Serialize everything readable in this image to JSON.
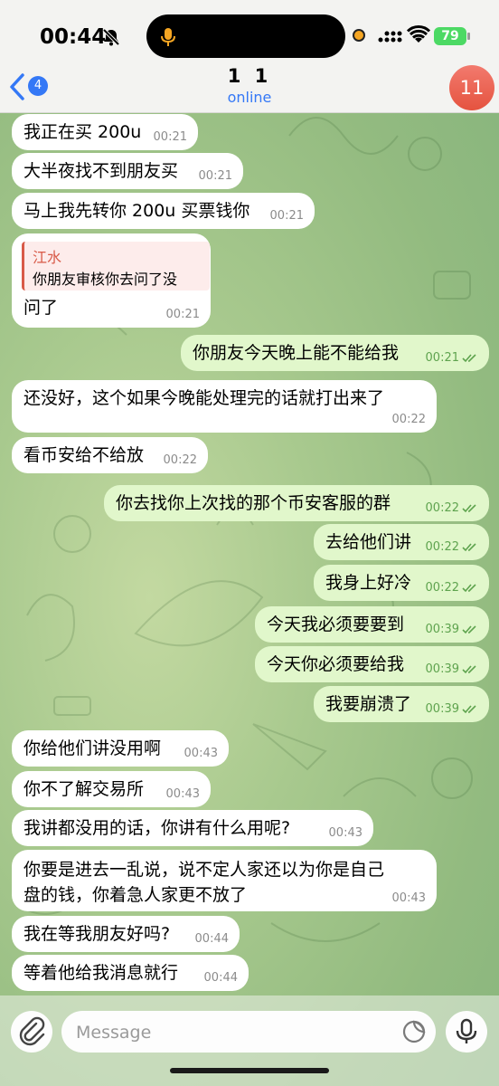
{
  "status_bar": {
    "time": "00:44",
    "battery": "79"
  },
  "header": {
    "back_badge": "4",
    "title": "1 1",
    "subtitle": "online",
    "avatar_text": "11"
  },
  "messages": [
    {
      "dir": "in",
      "text": "我正在买 200u",
      "time": "00:21"
    },
    {
      "dir": "in",
      "text": "大半夜找不到朋友买",
      "time": "00:21"
    },
    {
      "dir": "in",
      "text": "马上我先转你 200u 买票钱你",
      "time": "00:21"
    },
    {
      "dir": "in",
      "reply_name": "江水",
      "reply_text": "你朋友审核你去问了没",
      "text": "问了",
      "time": "00:21"
    },
    {
      "dir": "out",
      "text": "你朋友今天晚上能不能给我",
      "time": "00:21"
    },
    {
      "dir": "in",
      "text": "还没好，这个如果今晚能处理完的话就打出来了",
      "time": "00:22"
    },
    {
      "dir": "in",
      "text": "看币安给不给放",
      "time": "00:22"
    },
    {
      "dir": "out",
      "text": "你去找你上次找的那个币安客服的群",
      "time": "00:22"
    },
    {
      "dir": "out",
      "text": "去给他们讲",
      "time": "00:22"
    },
    {
      "dir": "out",
      "text": "我身上好冷",
      "time": "00:22"
    },
    {
      "dir": "out",
      "text": "今天我必须要要到",
      "time": "00:39"
    },
    {
      "dir": "out",
      "text": "今天你必须要给我",
      "time": "00:39"
    },
    {
      "dir": "out",
      "text": "我要崩溃了",
      "time": "00:39"
    },
    {
      "dir": "in",
      "text": "你给他们讲没用啊",
      "time": "00:43"
    },
    {
      "dir": "in",
      "text": "你不了解交易所",
      "time": "00:43"
    },
    {
      "dir": "in",
      "text": "我讲都没用的话，你讲有什么用呢?",
      "time": "00:43"
    },
    {
      "dir": "in",
      "line1": "你要是进去一乱说，说不定人家还以为你是自己",
      "line2": "盘的钱，你着急人家更不放了",
      "time": "00:43"
    },
    {
      "dir": "in",
      "text": "我在等我朋友好吗?",
      "time": "00:44"
    },
    {
      "dir": "in",
      "text": "等着他给我消息就行",
      "time": "00:44"
    }
  ],
  "composer": {
    "placeholder": "Message"
  },
  "colors": {
    "accent": "#3478f6",
    "outgoing_bubble": "#e1f7cb",
    "incoming_bubble": "#ffffff",
    "read_check": "#5ea34e",
    "avatar": "#e5533f"
  },
  "icons": [
    "mute-bell-icon",
    "back-chevron-icon",
    "attach-paperclip-icon",
    "sticker-icon",
    "microphone-icon",
    "double-check-icon"
  ]
}
